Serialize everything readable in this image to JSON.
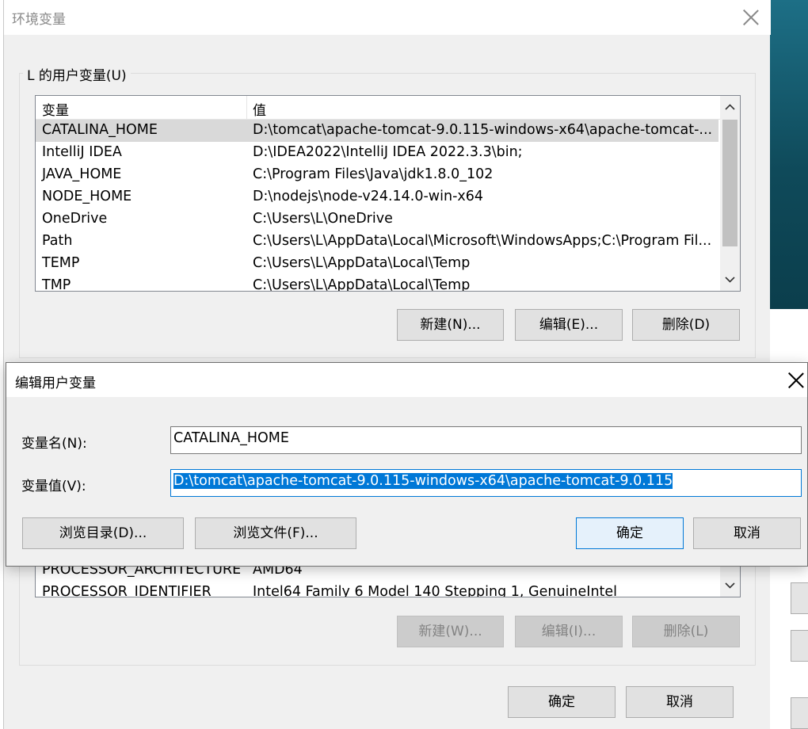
{
  "main_window": {
    "title": "环境变量",
    "user_group_label": "L 的用户变量(U)",
    "columns": {
      "name": "变量",
      "value": "值"
    },
    "user_vars": [
      {
        "name": "CATALINA_HOME",
        "value": "D:\\tomcat\\apache-tomcat-9.0.115-windows-x64\\apache-tomcat-...",
        "selected": true
      },
      {
        "name": "IntelliJ IDEA",
        "value": "D:\\IDEA2022\\IntelliJ IDEA 2022.3.3\\bin;"
      },
      {
        "name": "JAVA_HOME",
        "value": "C:\\Program Files\\Java\\jdk1.8.0_102"
      },
      {
        "name": "NODE_HOME",
        "value": "D:\\nodejs\\node-v24.14.0-win-x64"
      },
      {
        "name": "OneDrive",
        "value": "C:\\Users\\L\\OneDrive"
      },
      {
        "name": "Path",
        "value": "C:\\Users\\L\\AppData\\Local\\Microsoft\\WindowsApps;C:\\Program Fil..."
      },
      {
        "name": "TEMP",
        "value": "C:\\Users\\L\\AppData\\Local\\Temp"
      },
      {
        "name": "TMP",
        "value": "C:\\Users\\L\\AppData\\Local\\Temp"
      }
    ],
    "user_buttons": {
      "new": "新建(N)...",
      "edit": "编辑(E)...",
      "delete": "删除(D)"
    },
    "system_vars": [
      {
        "name": "PROCESSOR_ARCHITECTURE",
        "value": "AMD64"
      },
      {
        "name": "PROCESSOR_IDENTIFIER",
        "value": "Intel64 Family 6 Model 140 Stepping 1, GenuineIntel"
      }
    ],
    "system_buttons": {
      "new": "新建(W)...",
      "edit": "编辑(I)...",
      "delete": "删除(L)"
    },
    "ok": "确定",
    "cancel": "取消"
  },
  "edit_dialog": {
    "title": "编辑用户变量",
    "name_label": "变量名(N):",
    "name_value": "CATALINA_HOME",
    "value_label": "变量值(V):",
    "value_value": "D:\\tomcat\\apache-tomcat-9.0.115-windows-x64\\apache-tomcat-9.0.115",
    "browse_dir": "浏览目录(D)...",
    "browse_file": "浏览文件(F)...",
    "ok": "确定",
    "cancel": "取消"
  }
}
